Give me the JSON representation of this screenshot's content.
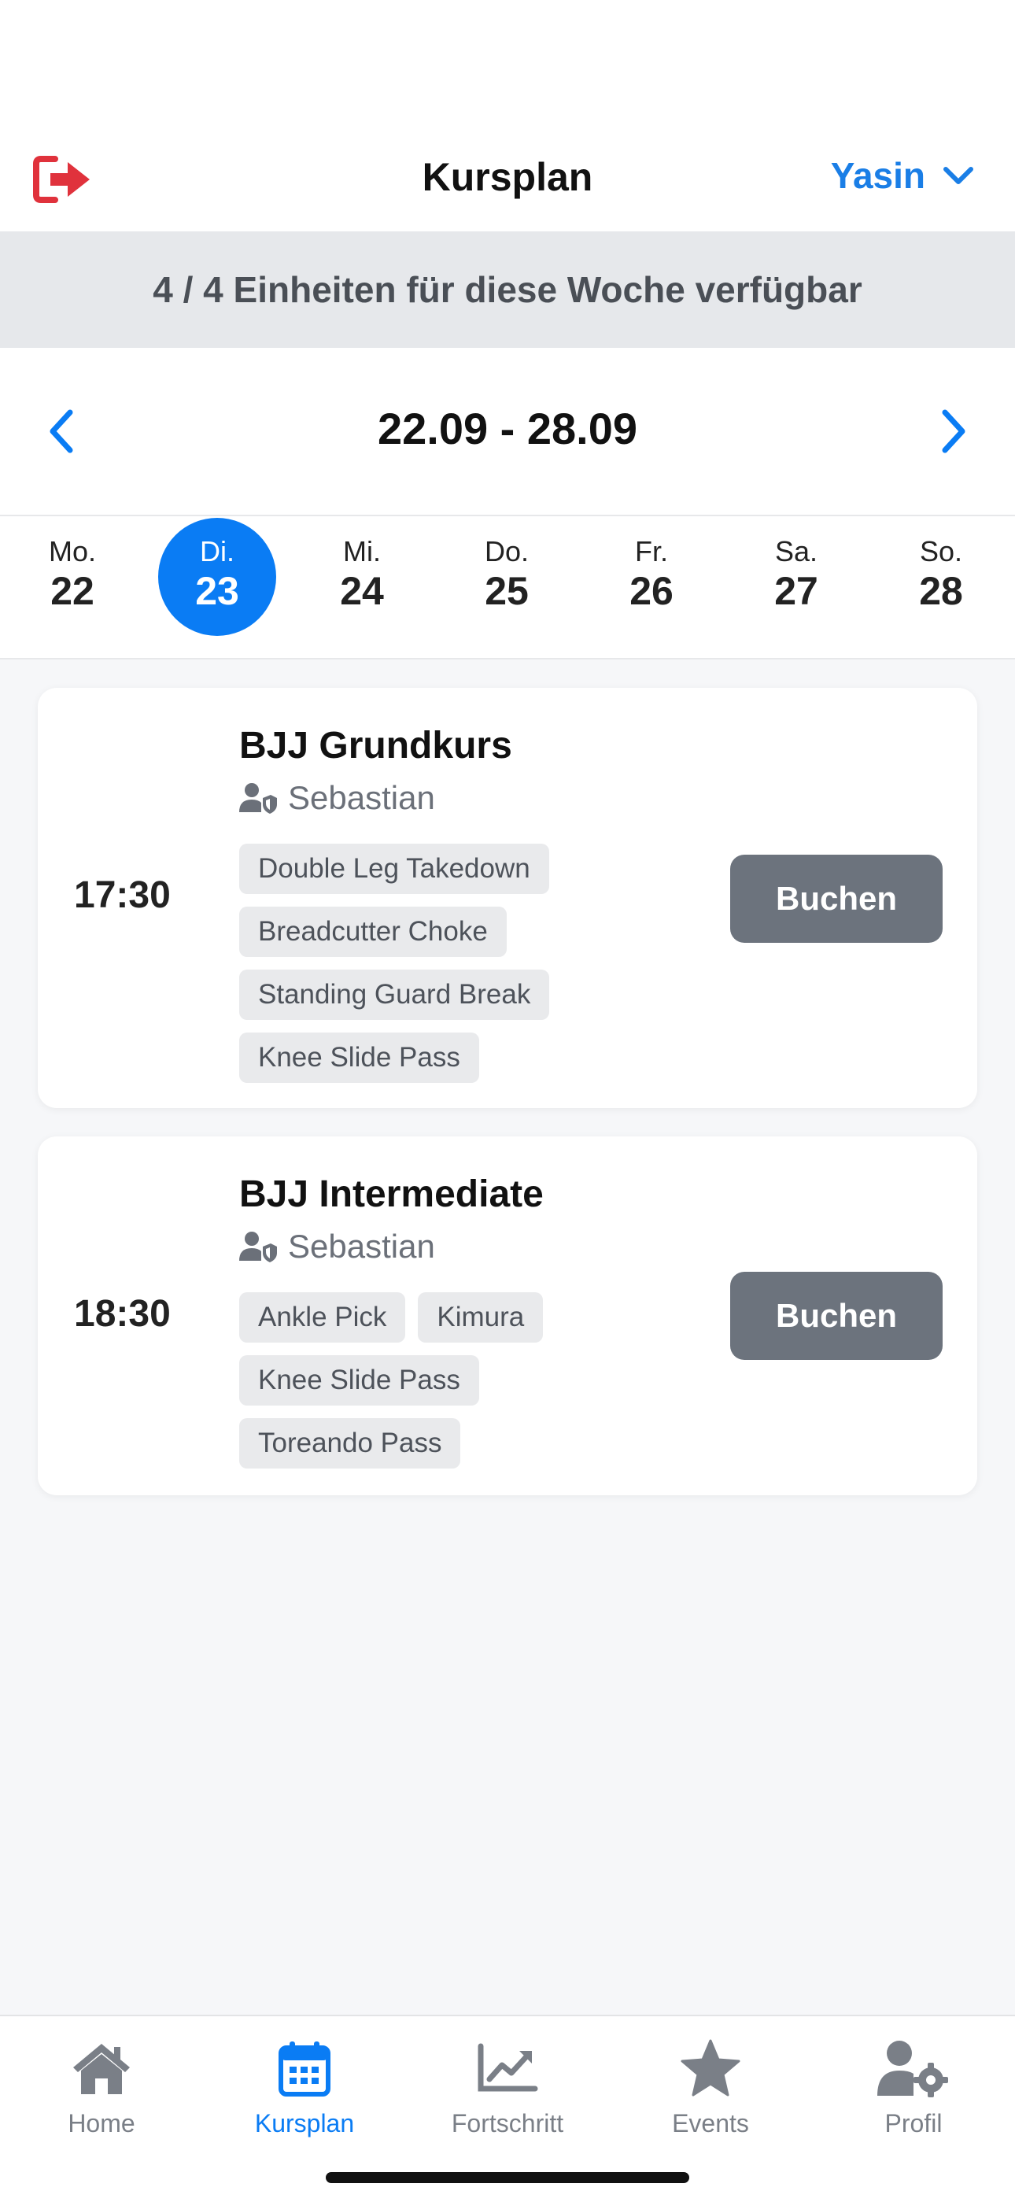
{
  "header": {
    "title": "Kursplan",
    "user_name": "Yasin",
    "logout_icon": "logout-icon",
    "accent": "#1a7ee6",
    "logout_color": "#e0323c"
  },
  "banner": {
    "text": "4 / 4 Einheiten für diese Woche verfügbar"
  },
  "week": {
    "range": "22.09 - 28.09",
    "days": [
      {
        "name": "Mo.",
        "num": "22",
        "active": false
      },
      {
        "name": "Di.",
        "num": "23",
        "active": true
      },
      {
        "name": "Mi.",
        "num": "24",
        "active": false
      },
      {
        "name": "Do.",
        "num": "25",
        "active": false
      },
      {
        "name": "Fr.",
        "num": "26",
        "active": false
      },
      {
        "name": "Sa.",
        "num": "27",
        "active": false
      },
      {
        "name": "So.",
        "num": "28",
        "active": false
      }
    ]
  },
  "courses": [
    {
      "time": "17:30",
      "title": "BJJ Grundkurs",
      "trainer": "Sebastian",
      "tags": [
        "Double Leg Takedown",
        "Breadcutter Choke",
        "Standing Guard Break",
        "Knee Slide Pass"
      ],
      "button": "Buchen"
    },
    {
      "time": "18:30",
      "title": "BJJ Intermediate",
      "trainer": "Sebastian",
      "tags": [
        "Ankle Pick",
        "Kimura",
        "Knee Slide Pass",
        "Toreando Pass"
      ],
      "button": "Buchen"
    }
  ],
  "tabs": [
    {
      "label": "Home",
      "icon": "home-icon",
      "active": false
    },
    {
      "label": "Kursplan",
      "icon": "calendar-icon",
      "active": true
    },
    {
      "label": "Fortschritt",
      "icon": "chart-line-icon",
      "active": false
    },
    {
      "label": "Events",
      "icon": "star-icon",
      "active": false
    },
    {
      "label": "Profil",
      "icon": "user-gear-icon",
      "active": false
    }
  ],
  "colors": {
    "primary": "#0a7cf4",
    "button_gray": "#6c737d",
    "tab_inactive": "#7a7f87"
  }
}
